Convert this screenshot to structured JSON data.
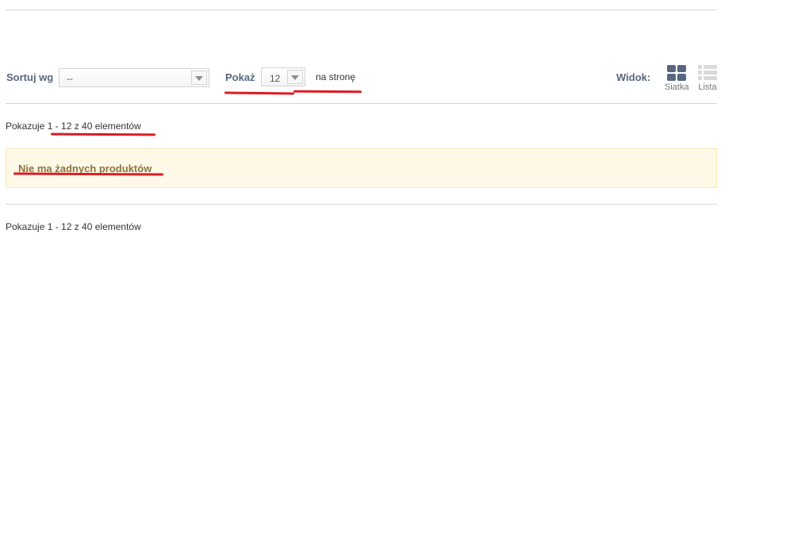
{
  "toolbar": {
    "sort_label": "Sortuj wg",
    "sort_value": "--",
    "show_label": "Pokaż",
    "show_value": "12",
    "per_page_label": "na stronę",
    "view_label": "Widok:",
    "view_grid_label": "Siatka",
    "view_list_label": "Lista"
  },
  "product_count_top": "Pokazuje 1 - 12 z 40 elementów",
  "alert": {
    "message": "Nie ma żadnych produktów"
  },
  "product_count_bottom": "Pokazuje 1 - 12 z 40 elementów",
  "colors": {
    "label": "#56677f",
    "alert_background": "#fef9e7",
    "alert_text": "#8a7440",
    "annotation_underline": "#e01a22"
  },
  "icons": [
    "chevron-down-icon",
    "grid-view-icon",
    "list-view-icon"
  ]
}
